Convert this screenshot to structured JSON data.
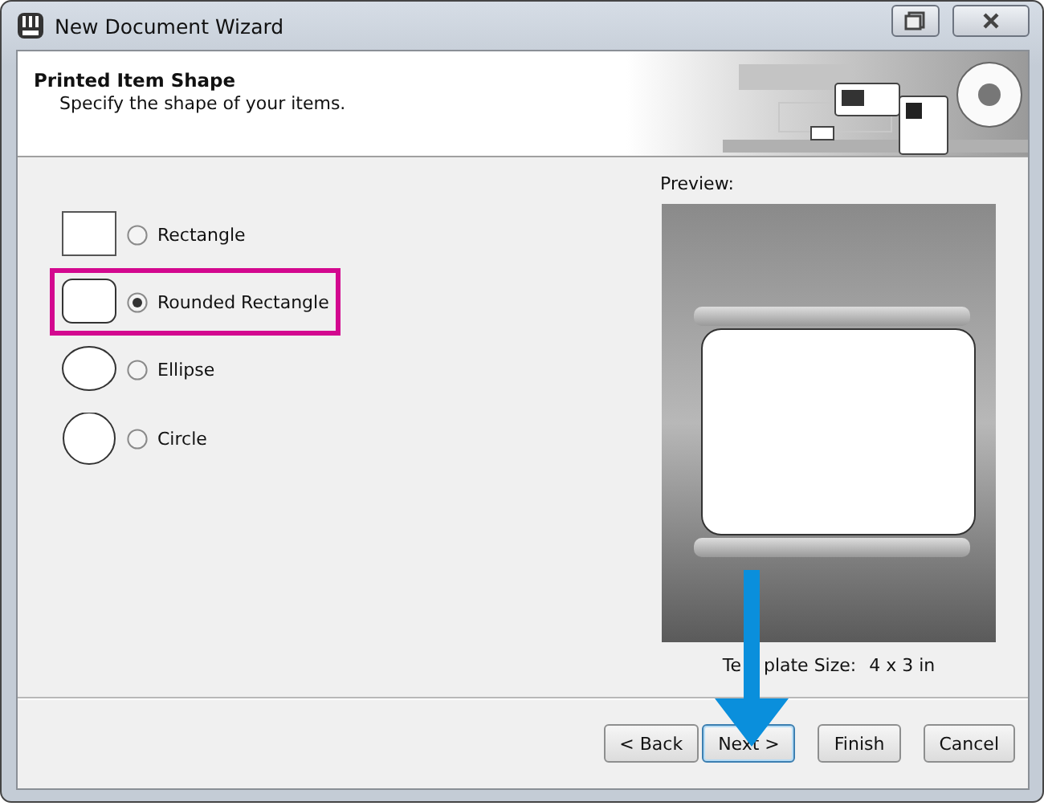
{
  "window": {
    "title": "New Document Wizard"
  },
  "header": {
    "title": "Printed Item Shape",
    "subtitle": "Specify the shape of your items."
  },
  "shapes": [
    {
      "label": "Rectangle",
      "kind": "rectangle",
      "selected": false
    },
    {
      "label": "Rounded Rectangle",
      "kind": "rounded",
      "selected": true
    },
    {
      "label": "Ellipse",
      "kind": "ellipse",
      "selected": false
    },
    {
      "label": "Circle",
      "kind": "circle",
      "selected": false
    }
  ],
  "preview": {
    "label": "Preview:",
    "size_label_start": "Te",
    "size_label_end": "plate Size:",
    "size_value": "4 x 3 in"
  },
  "buttons": [
    {
      "label": "< Back",
      "default": false
    },
    {
      "label": "Next >",
      "default": true
    },
    {
      "label": "Finish",
      "default": false
    },
    {
      "label": "Cancel",
      "default": false
    }
  ]
}
